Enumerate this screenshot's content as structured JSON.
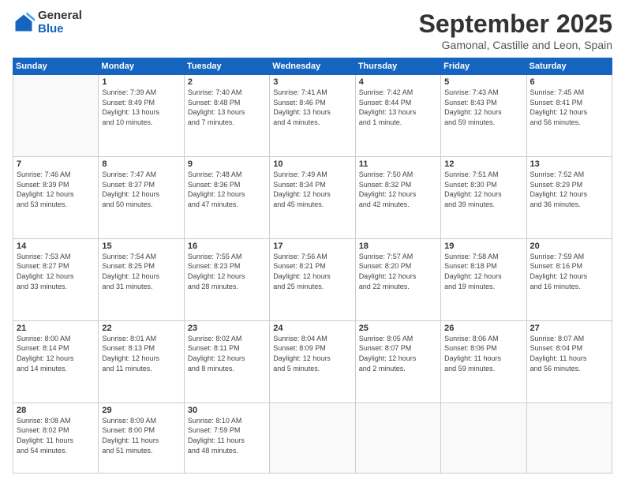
{
  "logo": {
    "general": "General",
    "blue": "Blue"
  },
  "header": {
    "title": "September 2025",
    "location": "Gamonal, Castille and Leon, Spain"
  },
  "weekdays": [
    "Sunday",
    "Monday",
    "Tuesday",
    "Wednesday",
    "Thursday",
    "Friday",
    "Saturday"
  ],
  "weeks": [
    [
      {
        "day": "",
        "info": ""
      },
      {
        "day": "1",
        "info": "Sunrise: 7:39 AM\nSunset: 8:49 PM\nDaylight: 13 hours\nand 10 minutes."
      },
      {
        "day": "2",
        "info": "Sunrise: 7:40 AM\nSunset: 8:48 PM\nDaylight: 13 hours\nand 7 minutes."
      },
      {
        "day": "3",
        "info": "Sunrise: 7:41 AM\nSunset: 8:46 PM\nDaylight: 13 hours\nand 4 minutes."
      },
      {
        "day": "4",
        "info": "Sunrise: 7:42 AM\nSunset: 8:44 PM\nDaylight: 13 hours\nand 1 minute."
      },
      {
        "day": "5",
        "info": "Sunrise: 7:43 AM\nSunset: 8:43 PM\nDaylight: 12 hours\nand 59 minutes."
      },
      {
        "day": "6",
        "info": "Sunrise: 7:45 AM\nSunset: 8:41 PM\nDaylight: 12 hours\nand 56 minutes."
      }
    ],
    [
      {
        "day": "7",
        "info": "Sunrise: 7:46 AM\nSunset: 8:39 PM\nDaylight: 12 hours\nand 53 minutes."
      },
      {
        "day": "8",
        "info": "Sunrise: 7:47 AM\nSunset: 8:37 PM\nDaylight: 12 hours\nand 50 minutes."
      },
      {
        "day": "9",
        "info": "Sunrise: 7:48 AM\nSunset: 8:36 PM\nDaylight: 12 hours\nand 47 minutes."
      },
      {
        "day": "10",
        "info": "Sunrise: 7:49 AM\nSunset: 8:34 PM\nDaylight: 12 hours\nand 45 minutes."
      },
      {
        "day": "11",
        "info": "Sunrise: 7:50 AM\nSunset: 8:32 PM\nDaylight: 12 hours\nand 42 minutes."
      },
      {
        "day": "12",
        "info": "Sunrise: 7:51 AM\nSunset: 8:30 PM\nDaylight: 12 hours\nand 39 minutes."
      },
      {
        "day": "13",
        "info": "Sunrise: 7:52 AM\nSunset: 8:29 PM\nDaylight: 12 hours\nand 36 minutes."
      }
    ],
    [
      {
        "day": "14",
        "info": "Sunrise: 7:53 AM\nSunset: 8:27 PM\nDaylight: 12 hours\nand 33 minutes."
      },
      {
        "day": "15",
        "info": "Sunrise: 7:54 AM\nSunset: 8:25 PM\nDaylight: 12 hours\nand 31 minutes."
      },
      {
        "day": "16",
        "info": "Sunrise: 7:55 AM\nSunset: 8:23 PM\nDaylight: 12 hours\nand 28 minutes."
      },
      {
        "day": "17",
        "info": "Sunrise: 7:56 AM\nSunset: 8:21 PM\nDaylight: 12 hours\nand 25 minutes."
      },
      {
        "day": "18",
        "info": "Sunrise: 7:57 AM\nSunset: 8:20 PM\nDaylight: 12 hours\nand 22 minutes."
      },
      {
        "day": "19",
        "info": "Sunrise: 7:58 AM\nSunset: 8:18 PM\nDaylight: 12 hours\nand 19 minutes."
      },
      {
        "day": "20",
        "info": "Sunrise: 7:59 AM\nSunset: 8:16 PM\nDaylight: 12 hours\nand 16 minutes."
      }
    ],
    [
      {
        "day": "21",
        "info": "Sunrise: 8:00 AM\nSunset: 8:14 PM\nDaylight: 12 hours\nand 14 minutes."
      },
      {
        "day": "22",
        "info": "Sunrise: 8:01 AM\nSunset: 8:13 PM\nDaylight: 12 hours\nand 11 minutes."
      },
      {
        "day": "23",
        "info": "Sunrise: 8:02 AM\nSunset: 8:11 PM\nDaylight: 12 hours\nand 8 minutes."
      },
      {
        "day": "24",
        "info": "Sunrise: 8:04 AM\nSunset: 8:09 PM\nDaylight: 12 hours\nand 5 minutes."
      },
      {
        "day": "25",
        "info": "Sunrise: 8:05 AM\nSunset: 8:07 PM\nDaylight: 12 hours\nand 2 minutes."
      },
      {
        "day": "26",
        "info": "Sunrise: 8:06 AM\nSunset: 8:06 PM\nDaylight: 11 hours\nand 59 minutes."
      },
      {
        "day": "27",
        "info": "Sunrise: 8:07 AM\nSunset: 8:04 PM\nDaylight: 11 hours\nand 56 minutes."
      }
    ],
    [
      {
        "day": "28",
        "info": "Sunrise: 8:08 AM\nSunset: 8:02 PM\nDaylight: 11 hours\nand 54 minutes."
      },
      {
        "day": "29",
        "info": "Sunrise: 8:09 AM\nSunset: 8:00 PM\nDaylight: 11 hours\nand 51 minutes."
      },
      {
        "day": "30",
        "info": "Sunrise: 8:10 AM\nSunset: 7:59 PM\nDaylight: 11 hours\nand 48 minutes."
      },
      {
        "day": "",
        "info": ""
      },
      {
        "day": "",
        "info": ""
      },
      {
        "day": "",
        "info": ""
      },
      {
        "day": "",
        "info": ""
      }
    ]
  ]
}
